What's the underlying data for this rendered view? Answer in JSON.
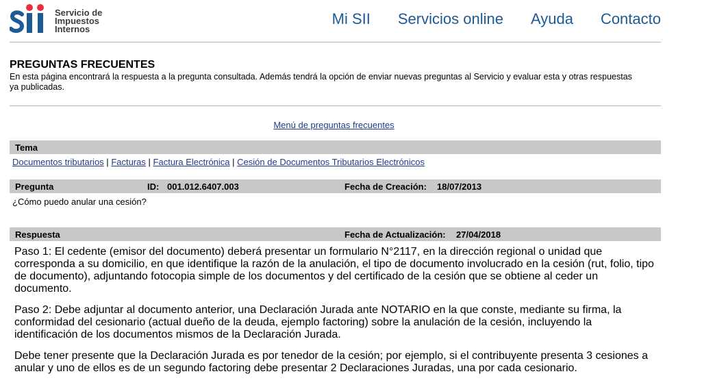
{
  "header": {
    "logo_text_lines": [
      "Servicio de",
      "Impuestos",
      "Internos"
    ],
    "nav": [
      "Mi SII",
      "Servicios online",
      "Ayuda",
      "Contacto"
    ],
    "brand_color": "#1d5b94"
  },
  "page": {
    "title": "PREGUNTAS FRECUENTES",
    "intro": "En esta página encontrará la respuesta a la pregunta consultada. Además tendrá la opción de enviar nuevas preguntas al Servicio y evaluar esta y otras respuestas ya publicadas.",
    "menu_link": "Menú de preguntas frecuentes"
  },
  "tema": {
    "label": "Tema",
    "breadcrumb": [
      "Documentos tributarios",
      "Facturas",
      "Factura Electrónica",
      "Cesión de Documentos Tributarios Electrónicos"
    ],
    "separator": "|"
  },
  "pregunta": {
    "label": "Pregunta",
    "id_label": "ID:",
    "id_value": "001.012.6407.003",
    "created_label": "Fecha de Creación:",
    "created_value": "18/07/2013",
    "text": "¿Cómo puedo anular una cesión?"
  },
  "respuesta": {
    "label": "Respuesta",
    "updated_label": "Fecha de Actualización:",
    "updated_value": "27/04/2018",
    "paragraphs": [
      "Paso 1: El cedente (emisor del documento) deberá presentar un formulario N°2117, en la dirección regional o unidad que corresponda a su domicilio, en que identifique la razón de la anulación, el tipo de documento involucrado en la cesión (rut, folio, tipo de documento), adjuntando fotocopia simple de los documentos y del certificado de la cesión que se obtiene al ceder un documento.",
      "Paso 2: Debe adjuntar al documento anterior, una Declaración Jurada ante NOTARIO en la que conste, mediante su firma, la conformidad del cesionario (actual dueño de la deuda, ejemplo factoring) sobre la anulación de la cesión, incluyendo la identificación de los documentos mismos de la Declaración Jurada.",
      "Debe tener presente que la Declaración Jurada es por tenedor de la cesión; por ejemplo, si el contribuyente presenta 3 cesiones a anular y uno de ellos es de un segundo factoring debe presentar 2 Declaraciones Juradas, una por cada cesionario."
    ]
  }
}
